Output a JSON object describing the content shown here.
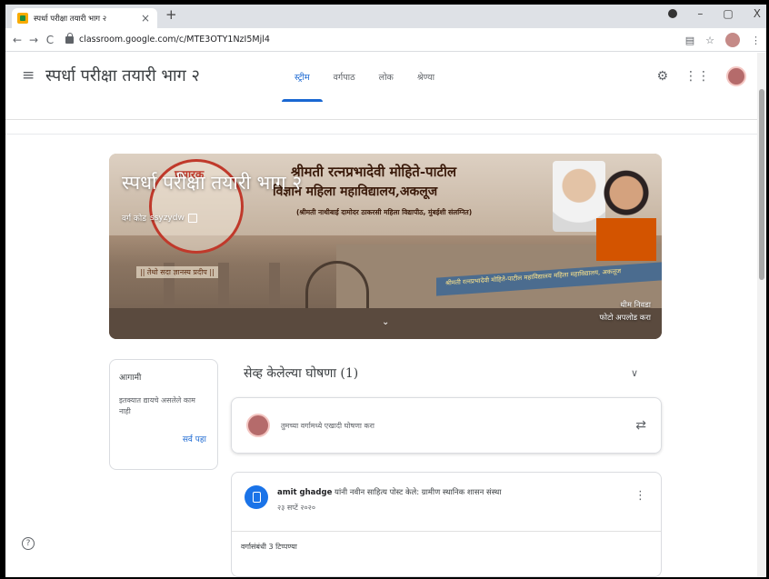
{
  "browser": {
    "tab_title": "स्पर्धा परीक्षा तयारी भाग २",
    "tab_close": "×",
    "new_tab": "+",
    "url": "classroom.google.com/c/MTE3OTY1NzI5Mjl4",
    "window_controls": [
      "–",
      "▢",
      "X"
    ]
  },
  "appbar": {
    "class_name": "स्पर्धा परीक्षा तयारी भाग २",
    "tabs": [
      {
        "label": "स्ट्रीम",
        "active": true
      },
      {
        "label": "वर्गपाठ",
        "active": false
      },
      {
        "label": "लोक",
        "active": false
      },
      {
        "label": "श्रेण्या",
        "active": false
      }
    ]
  },
  "banner": {
    "class_title": "स्पर्धा परीक्षा तयारी भाग २",
    "class_code_label": "वर्ग कोड",
    "class_code": "ssyzydw",
    "logo_text": "प्रसारक",
    "motto": "|| तेथो सदा ज्ञानस्य प्रदीप ||",
    "heading1": "श्रीमती रत्नप्रभादेवी मोहिते-पाटील",
    "heading2": "विज्ञान महिला महाविद्यालय,अकलूज",
    "heading3": "(श्रीमती नाथीबाई दामोदर ठाकरसी महिला विद्यापीठ, मुंबईशी संलग्नित)",
    "signboard": "श्रीमती रत्नप्रभादेवी मोहिते-पाटील महाविद्यालय महिला महाविद्यालय, अकलूज",
    "select_theme": "थीम निवडा",
    "upload_photo": "फोटो अपलोड करा"
  },
  "upcoming": {
    "title": "आगामी",
    "empty_text": "इतक्यात द्यायचे असलेले काम नाही",
    "view_all": "सर्व पहा"
  },
  "saved": {
    "title": "सेव्ह केलेल्या घोषणा (1)"
  },
  "postbox": {
    "placeholder": "तुमच्या वर्गामध्ये एखादी घोषणा करा"
  },
  "material": {
    "author": "amit ghadge",
    "action": " यांनी नवीन साहित्य पोस्ट केले: ग्रामीण स्थानिक शासन संस्था",
    "date": "२३ सप्टें २०२०",
    "comments": "वर्गासंबंधी 3 टिप्पण्या"
  },
  "help": "?"
}
